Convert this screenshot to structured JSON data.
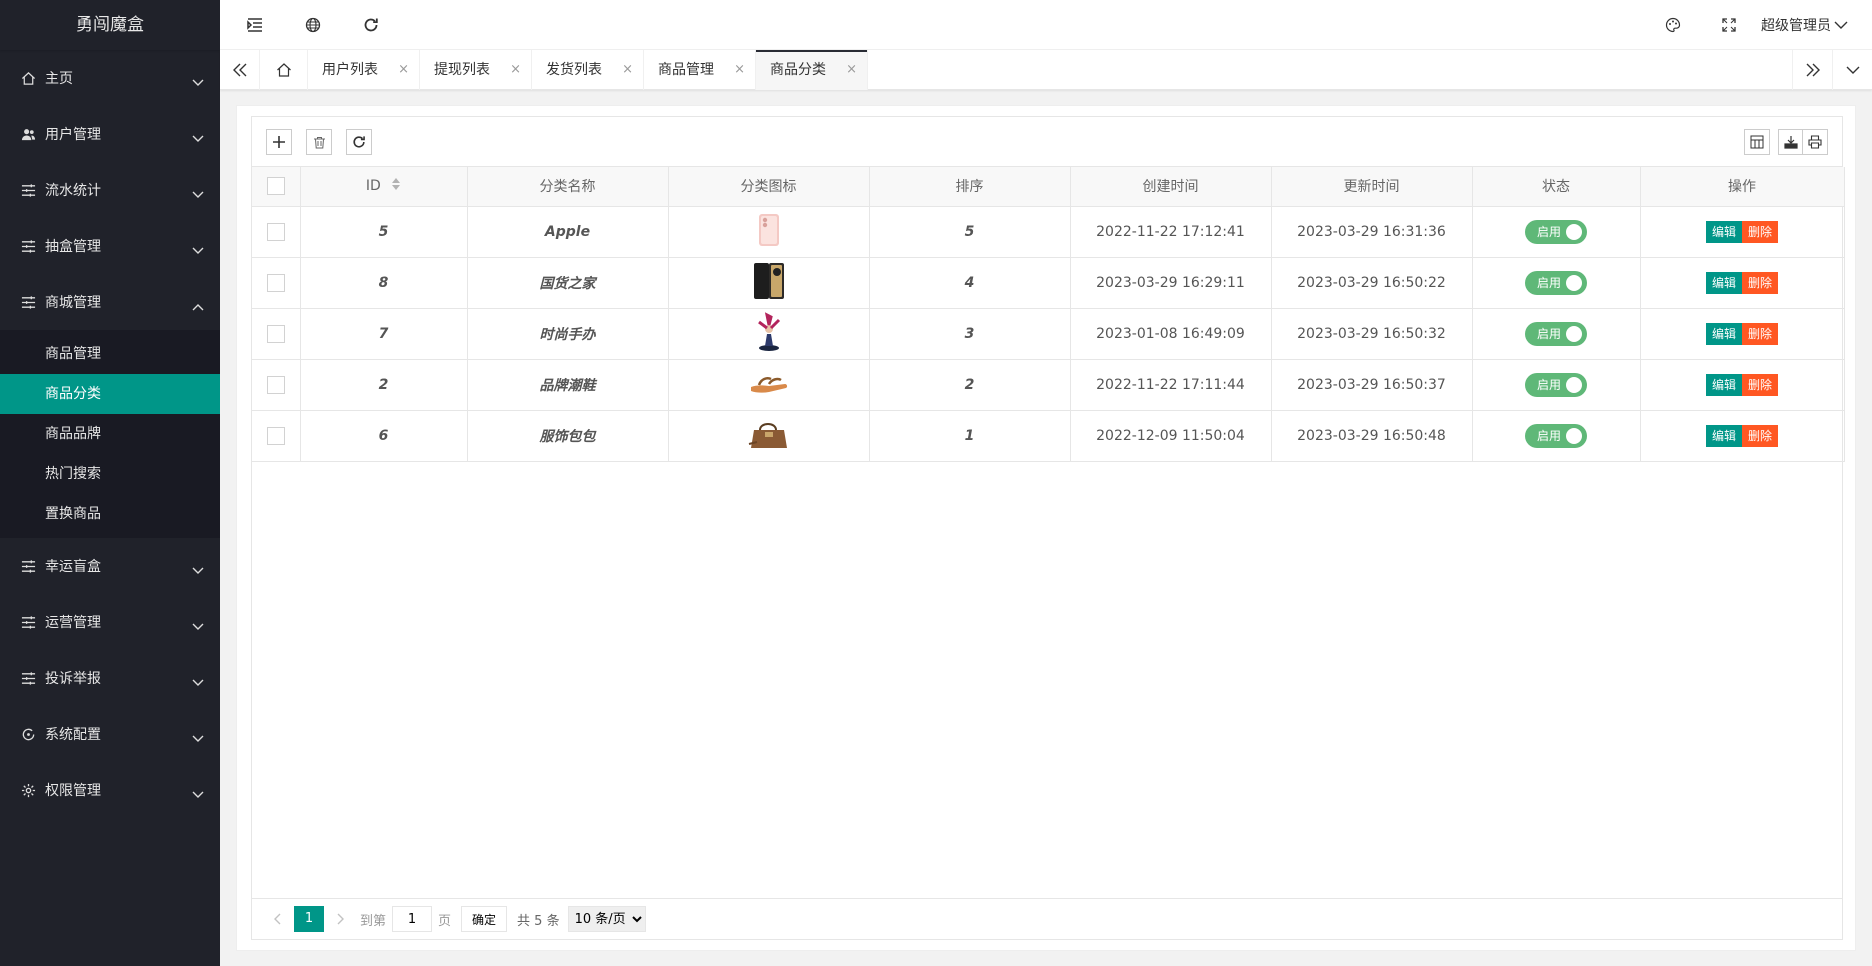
{
  "app": {
    "title": "勇闯魔盒"
  },
  "sidebar": {
    "items": [
      {
        "label": "主页",
        "icon": "home-icon"
      },
      {
        "label": "用户管理",
        "icon": "users-icon"
      },
      {
        "label": "流水统计",
        "icon": "list-icon"
      },
      {
        "label": "抽盒管理",
        "icon": "list-icon"
      },
      {
        "label": "商城管理",
        "icon": "list-icon",
        "expanded": true,
        "children": [
          "商品管理",
          "商品分类",
          "商品品牌",
          "热门搜索",
          "置换商品"
        ],
        "active_child": 1
      },
      {
        "label": "幸运盲盒",
        "icon": "list-icon"
      },
      {
        "label": "运营管理",
        "icon": "list-icon"
      },
      {
        "label": "投诉举报",
        "icon": "list-icon"
      },
      {
        "label": "系统配置",
        "icon": "refresh-circle-icon"
      },
      {
        "label": "权限管理",
        "icon": "gear-icon"
      }
    ]
  },
  "header": {
    "user": "超级管理员"
  },
  "tabs": {
    "items": [
      "用户列表",
      "提现列表",
      "发货列表",
      "商品管理",
      "商品分类"
    ],
    "active": 4,
    "close_glyph": "×"
  },
  "table": {
    "columns": [
      "ID",
      "分类名称",
      "分类图标",
      "排序",
      "创建时间",
      "更新时间",
      "状态",
      "操作"
    ],
    "rows": [
      {
        "id": "5",
        "name": "Apple",
        "icon": "phone-pink",
        "sort": "5",
        "created": "2022-11-22 17:12:41",
        "updated": "2023-03-29 16:31:36",
        "status": "启用"
      },
      {
        "id": "8",
        "name": "国货之家",
        "icon": "phone-black",
        "sort": "4",
        "created": "2023-03-29 16:29:11",
        "updated": "2023-03-29 16:50:22",
        "status": "启用"
      },
      {
        "id": "7",
        "name": "时尚手办",
        "icon": "figure",
        "sort": "3",
        "created": "2023-01-08 16:49:09",
        "updated": "2023-03-29 16:50:32",
        "status": "启用"
      },
      {
        "id": "2",
        "name": "品牌潮鞋",
        "icon": "sandal",
        "sort": "2",
        "created": "2022-11-22 17:11:44",
        "updated": "2023-03-29 16:50:37",
        "status": "启用"
      },
      {
        "id": "6",
        "name": "服饰包包",
        "icon": "handbag",
        "sort": "1",
        "created": "2022-12-09 11:50:04",
        "updated": "2023-03-29 16:50:48",
        "status": "启用"
      }
    ],
    "edit_label": "编辑",
    "delete_label": "删除"
  },
  "pager": {
    "current": "1",
    "goto_label": "到第",
    "goto_value": "1",
    "page_label": "页",
    "ok_label": "确定",
    "total_label": "共 5 条",
    "per_page": "10 条/页"
  },
  "colors": {
    "sidebar_bg": "#20222a",
    "accent": "#009688",
    "switch_on": "#5fb878",
    "danger": "#ff5722"
  }
}
